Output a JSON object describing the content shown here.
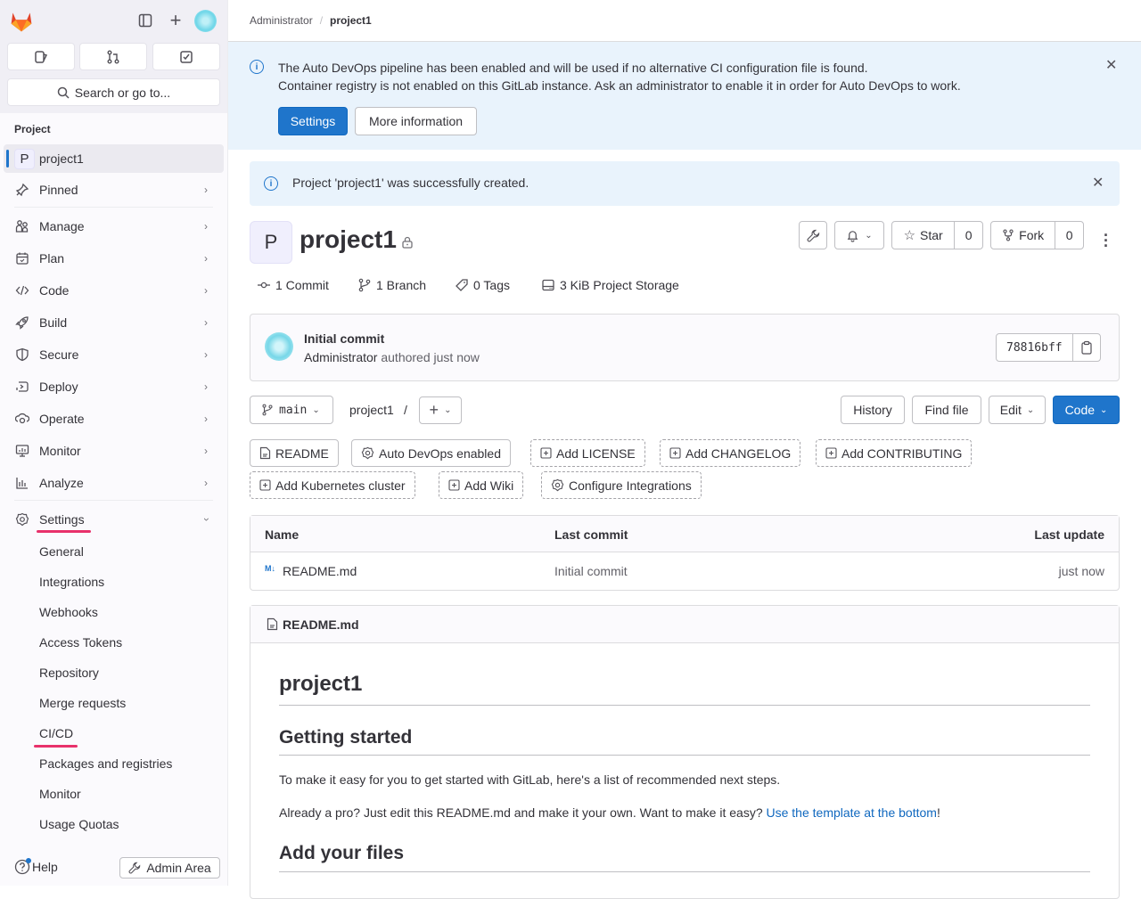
{
  "sidebar": {
    "search_label": "Search or go to...",
    "section_title": "Project",
    "project_initial": "P",
    "project_name": "project1",
    "pinned_label": "Pinned",
    "nav_items": [
      {
        "label": "Manage",
        "icon": "users-icon"
      },
      {
        "label": "Plan",
        "icon": "calendar-icon"
      },
      {
        "label": "Code",
        "icon": "code-icon"
      },
      {
        "label": "Build",
        "icon": "rocket-icon"
      },
      {
        "label": "Secure",
        "icon": "shield-icon"
      },
      {
        "label": "Deploy",
        "icon": "deploy-icon"
      },
      {
        "label": "Operate",
        "icon": "cloud-gear-icon"
      },
      {
        "label": "Monitor",
        "icon": "monitor-icon"
      },
      {
        "label": "Analyze",
        "icon": "chart-icon"
      }
    ],
    "settings_label": "Settings",
    "settings_sub": [
      "General",
      "Integrations",
      "Webhooks",
      "Access Tokens",
      "Repository",
      "Merge requests",
      "CI/CD",
      "Packages and registries",
      "Monitor",
      "Usage Quotas"
    ],
    "help_label": "Help",
    "admin_label": "Admin Area"
  },
  "breadcrumb": {
    "parent": "Administrator",
    "sep": "/",
    "current": "project1"
  },
  "autodevops_alert": {
    "line1": "The Auto DevOps pipeline has been enabled and will be used if no alternative CI configuration file is found.",
    "line2": "Container registry is not enabled on this GitLab instance. Ask an administrator to enable it in order for Auto DevOps to work.",
    "settings_btn": "Settings",
    "more_btn": "More information"
  },
  "created_alert": {
    "text": "Project 'project1' was successfully created."
  },
  "project": {
    "initial": "P",
    "name": "project1",
    "star_label": "Star",
    "star_count": "0",
    "fork_label": "Fork",
    "fork_count": "0",
    "stats": {
      "commits": "1 Commit",
      "branches": "1 Branch",
      "tags": "0 Tags",
      "storage": "3 KiB Project Storage"
    }
  },
  "last_commit": {
    "title": "Initial commit",
    "author": "Administrator",
    "meta": "authored just now",
    "sha": "78816bff"
  },
  "repo_toolbar": {
    "branch": "main",
    "path": "project1",
    "path_sep": "/",
    "history": "History",
    "find_file": "Find file",
    "edit": "Edit",
    "code": "Code"
  },
  "shortcuts": [
    {
      "label": "README",
      "icon": "file-icon",
      "dashed": false
    },
    {
      "label": "Auto DevOps enabled",
      "icon": "gear-icon",
      "dashed": false
    },
    {
      "label": "Add LICENSE",
      "icon": "plus-square-icon",
      "dashed": true
    },
    {
      "label": "Add CHANGELOG",
      "icon": "plus-square-icon",
      "dashed": true
    },
    {
      "label": "Add CONTRIBUTING",
      "icon": "plus-square-icon",
      "dashed": true
    },
    {
      "label": "Add Kubernetes cluster",
      "icon": "plus-square-icon",
      "dashed": true
    },
    {
      "label": "Add Wiki",
      "icon": "plus-square-icon",
      "dashed": true
    },
    {
      "label": "Configure Integrations",
      "icon": "gear-icon",
      "dashed": true
    }
  ],
  "file_table": {
    "headers": [
      "Name",
      "Last commit",
      "Last update"
    ],
    "rows": [
      {
        "name": "README.md",
        "last_commit": "Initial commit",
        "last_update": "just now"
      }
    ]
  },
  "readme": {
    "filename": "README.md",
    "h1": "project1",
    "h2_getting_started": "Getting started",
    "p1": "To make it easy for you to get started with GitLab, here's a list of recommended next steps.",
    "p2_prefix": "Already a pro? Just edit this README.md and make it your own. Want to make it easy? ",
    "p2_link": "Use the template at the bottom",
    "p2_suffix": "!",
    "h2_add_files": "Add your files"
  },
  "colors": {
    "accent": "#1f75cb",
    "alert_bg": "#e9f3fc",
    "active_underline": "#e8316b"
  }
}
